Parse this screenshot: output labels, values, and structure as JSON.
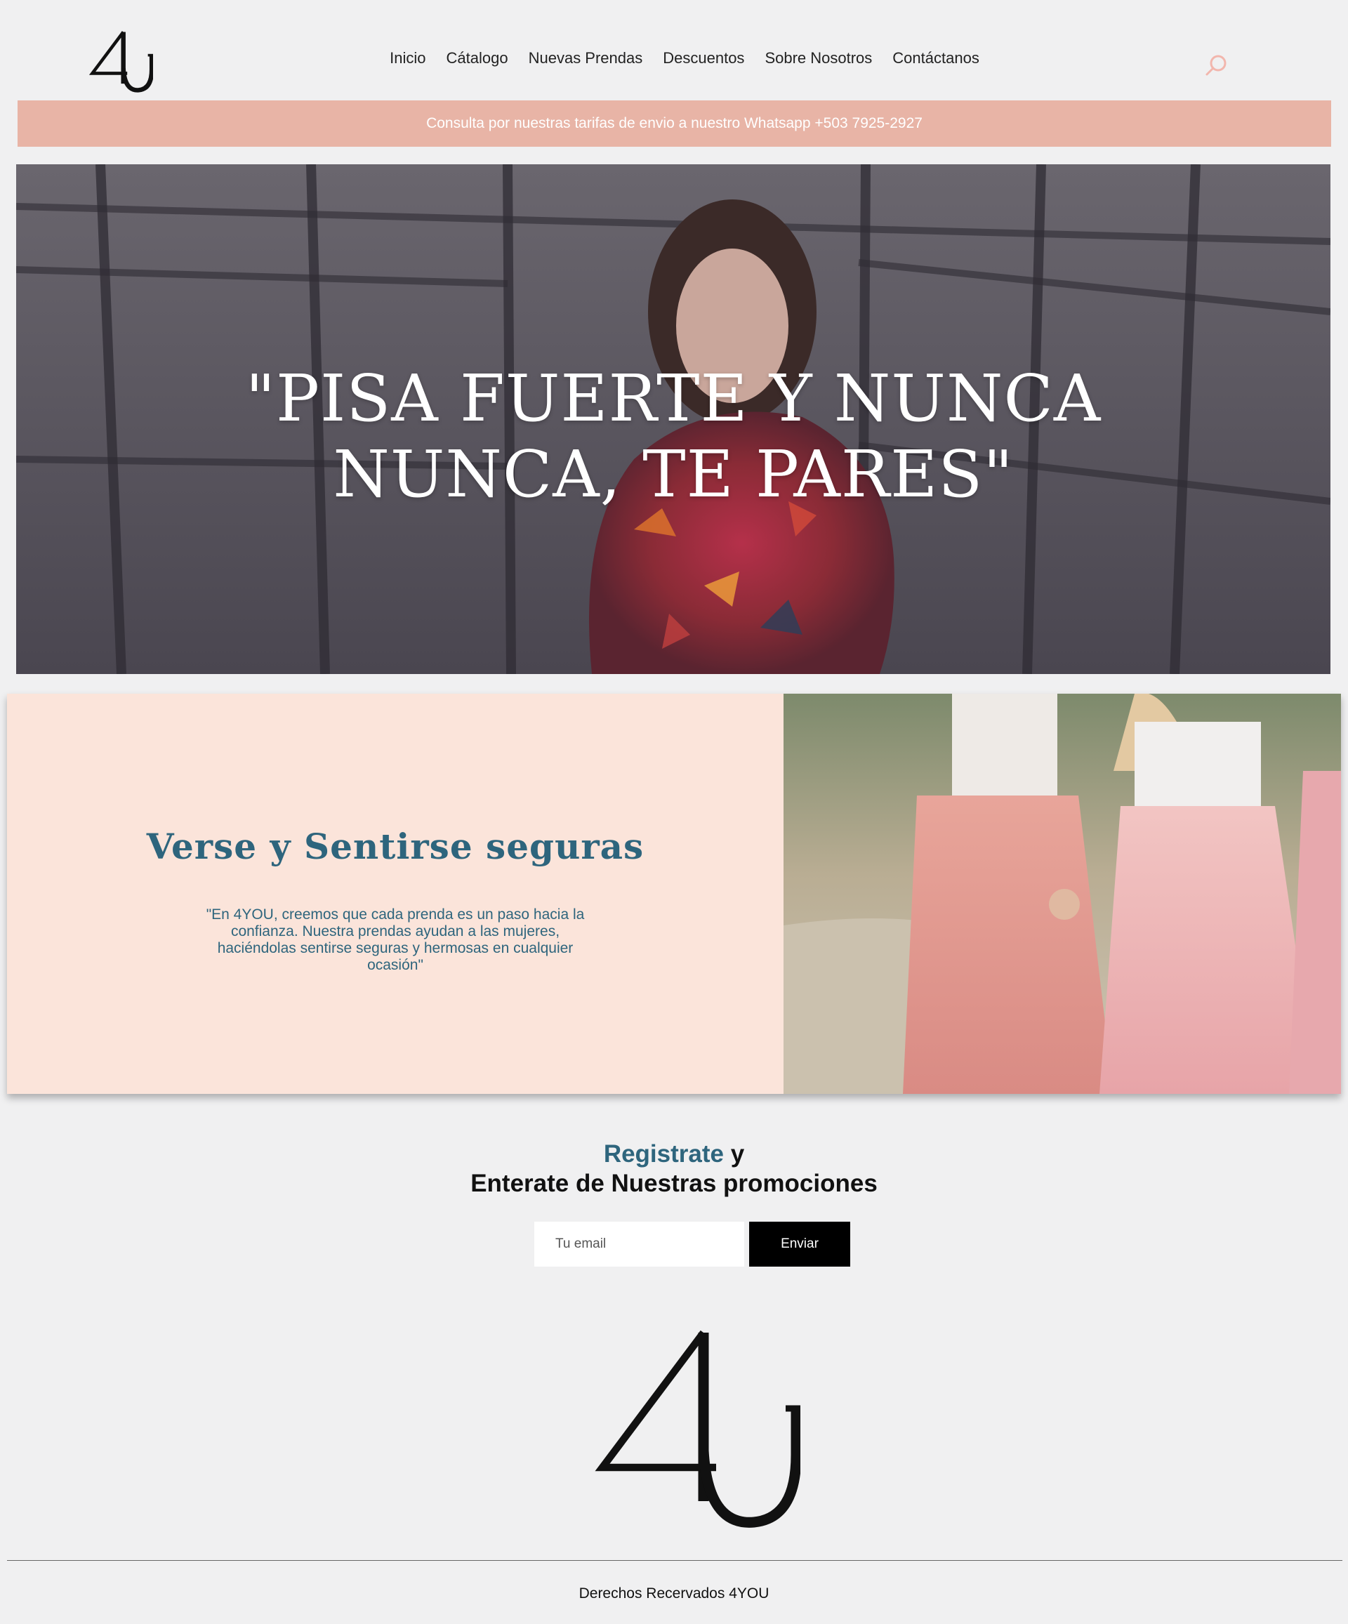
{
  "header": {
    "logo_text": "4U",
    "nav": [
      {
        "label": "Inicio"
      },
      {
        "label": "Cátalogo"
      },
      {
        "label": "Nuevas Prendas"
      },
      {
        "label": "Descuentos"
      },
      {
        "label": "Sobre Nosotros"
      },
      {
        "label": "Contáctanos"
      }
    ],
    "search_icon": "search-icon"
  },
  "promo": {
    "text": "Consulta por nuestras tarifas de envio a nuestro Whatsapp +503 7925-2927"
  },
  "hero": {
    "line1": "\"PISA FUERTE Y NUNCA",
    "line2": "NUNCA, TE PARES\""
  },
  "feature": {
    "heading": "Verse y Sentirse seguras",
    "body": "\"En 4YOU, creemos que cada prenda es un paso hacia la confianza. Nuestra prendas ayudan a las mujeres, haciéndolas sentirse seguras y hermosas en cualquier ocasión\""
  },
  "newsletter": {
    "title_accent": "Registrate",
    "title_rest": " y",
    "title_line2": "Enterate de Nuestras promociones",
    "email_placeholder": "Tu email",
    "button_label": "Enviar"
  },
  "footer": {
    "logo_text": "4U",
    "copyright": "Derechos Recervados 4YOU"
  },
  "colors": {
    "promo_bar": "#e8b4a6",
    "accent_teal": "#2e657d",
    "feature_bg": "#fbe4da",
    "search_icon": "#f2b6ad"
  }
}
